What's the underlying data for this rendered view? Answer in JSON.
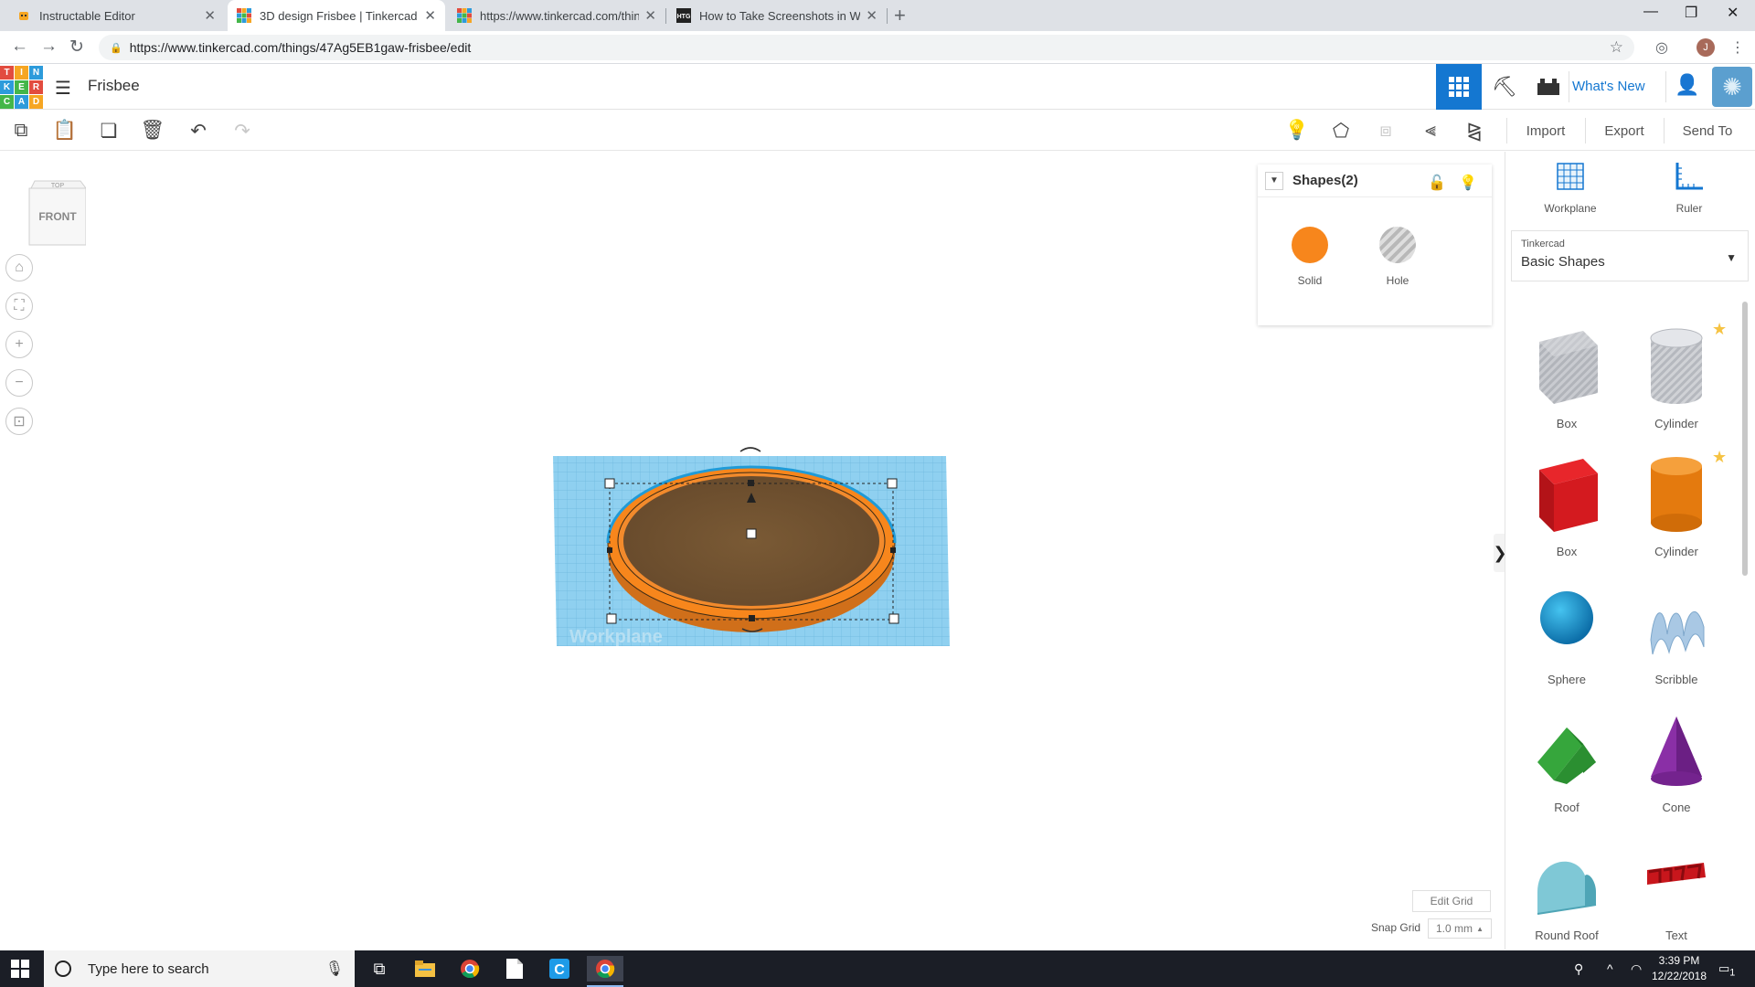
{
  "browser": {
    "tabs": [
      {
        "title": "Instructable Editor",
        "favicon": "instructables-robot-icon",
        "active": false
      },
      {
        "title": "3D design Frisbee | Tinkercad",
        "favicon": "tinkercad-icon",
        "active": true
      },
      {
        "title": "https://www.tinkercad.com/thing",
        "favicon": "tinkercad-icon",
        "active": false
      },
      {
        "title": "How to Take Screenshots in Winc",
        "favicon": "htg-icon",
        "active": false
      }
    ],
    "url": "https://www.tinkercad.com/things/47Ag5EB1gaw-frisbee/edit",
    "profile_initial": "J"
  },
  "app": {
    "logo_letters": [
      "T",
      "I",
      "N",
      "K",
      "E",
      "R",
      "C",
      "A",
      "D"
    ],
    "design_name": "Frisbee",
    "whats_new": "What's New"
  },
  "toolbar": {
    "import_label": "Import",
    "export_label": "Export",
    "send_to_label": "Send To"
  },
  "canvas": {
    "viewcube_top": "TOP",
    "viewcube_front": "FRONT",
    "workplane_label": "Workplane"
  },
  "inspector": {
    "title": "Shapes(2)",
    "solid_label": "Solid",
    "hole_label": "Hole",
    "solid_color": "#f7861c"
  },
  "grid": {
    "edit_grid": "Edit Grid",
    "snap_grid_label": "Snap Grid",
    "snap_grid_value": "1.0 mm"
  },
  "panel": {
    "workplane_label": "Workplane",
    "ruler_label": "Ruler",
    "library_provider": "Tinkercad",
    "library_name": "Basic Shapes",
    "shapes": [
      {
        "label": "Box",
        "icon": "box-hole-icon",
        "favorite": false
      },
      {
        "label": "Cylinder",
        "icon": "cylinder-hole-icon",
        "favorite": true
      },
      {
        "label": "Box",
        "icon": "box-red-icon",
        "favorite": false
      },
      {
        "label": "Cylinder",
        "icon": "cylinder-orange-icon",
        "favorite": true
      },
      {
        "label": "Sphere",
        "icon": "sphere-blue-icon",
        "favorite": false
      },
      {
        "label": "Scribble",
        "icon": "scribble-icon",
        "favorite": false
      },
      {
        "label": "Roof",
        "icon": "roof-green-icon",
        "favorite": false
      },
      {
        "label": "Cone",
        "icon": "cone-purple-icon",
        "favorite": false
      },
      {
        "label": "Round Roof",
        "icon": "round-roof-teal-icon",
        "favorite": false
      },
      {
        "label": "Text",
        "icon": "text-red-icon",
        "favorite": false
      }
    ]
  },
  "taskbar": {
    "search_placeholder": "Type here to search",
    "time": "3:39 PM",
    "date": "12/22/2018",
    "notification_count": "1"
  },
  "colors": {
    "accent": "#1477d1",
    "workplane": "#8fd0f0",
    "frisbee": "#f7861c"
  }
}
